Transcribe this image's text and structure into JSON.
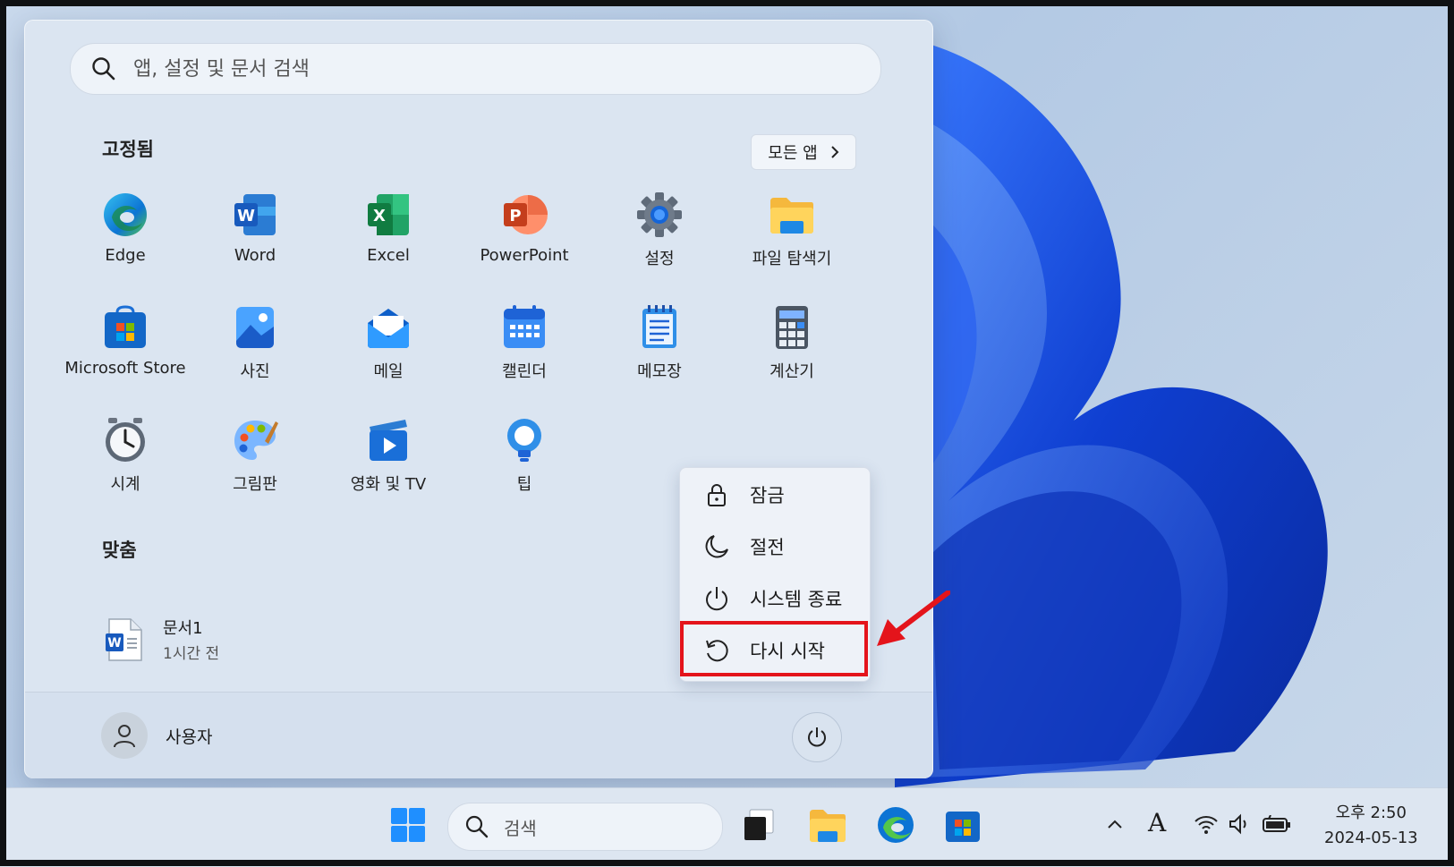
{
  "search": {
    "placeholder": "앱, 설정 및 문서 검색"
  },
  "pinned": {
    "title": "고정됨",
    "all_apps_label": "모든 앱",
    "apps": [
      {
        "label": "Edge"
      },
      {
        "label": "Word"
      },
      {
        "label": "Excel"
      },
      {
        "label": "PowerPoint"
      },
      {
        "label": "설정"
      },
      {
        "label": "파일 탐색기"
      },
      {
        "label": "Microsoft Store"
      },
      {
        "label": "사진"
      },
      {
        "label": "메일"
      },
      {
        "label": "캘린더"
      },
      {
        "label": "메모장"
      },
      {
        "label": "계산기"
      },
      {
        "label": "시계"
      },
      {
        "label": "그림판"
      },
      {
        "label": "영화 및 TV"
      },
      {
        "label": "팁"
      }
    ]
  },
  "recommended": {
    "title": "맞춤",
    "items": [
      {
        "name": "문서1",
        "time": "1시간 전"
      }
    ]
  },
  "user": {
    "name": "사용자"
  },
  "power_menu": {
    "items": [
      {
        "label": "잠금",
        "icon": "lock-icon"
      },
      {
        "label": "절전",
        "icon": "sleep-moon-icon"
      },
      {
        "label": "시스템 종료",
        "icon": "power-icon"
      },
      {
        "label": "다시 시작",
        "icon": "restart-icon"
      }
    ],
    "highlighted": "다시 시작"
  },
  "taskbar": {
    "search_label": "검색",
    "input_indicator": "A",
    "clock_time": "오후 2:50",
    "clock_date": "2024-05-13"
  },
  "colors": {
    "accent": "#0067c0",
    "highlight_box": "#e4141b",
    "wallpaper_bloom": "#1a4fd6"
  }
}
